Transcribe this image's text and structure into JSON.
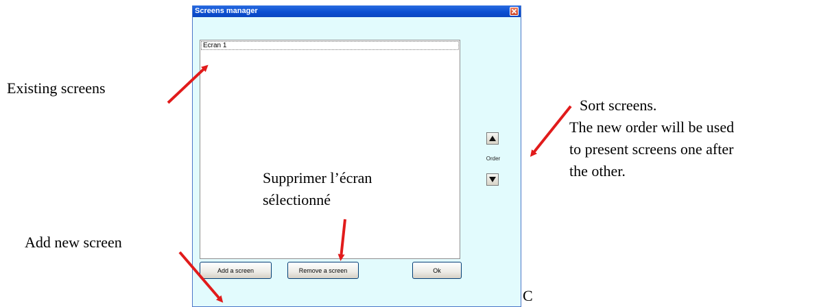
{
  "window": {
    "title": "Screens manager",
    "list_items": [
      "Ecran 1"
    ],
    "buttons": {
      "add": "Add a screen",
      "remove": "Remove a screen",
      "ok": "Ok"
    },
    "order_label": "Order"
  },
  "annotations": {
    "existing": "Existing screens",
    "add_new": "Add new screen",
    "remove_line1": "Supprimer l’écran",
    "remove_line2": "sélectionné",
    "sort_line1": "Sort screens.",
    "sort_line2": "The new order will be used",
    "sort_line3": "to present screens one after",
    "sort_line4": "the other.",
    "stray_char": "C"
  },
  "colors": {
    "titlebar": "#0b4fd2",
    "window_bg": "#e2fbfd",
    "arrow": "#e11b1b"
  }
}
